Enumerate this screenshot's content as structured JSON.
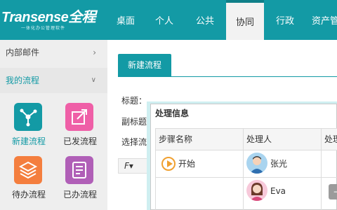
{
  "logo": {
    "name": "Transense全程",
    "tagline": "一体化办公管理软件"
  },
  "nav": {
    "items": [
      {
        "label": "桌面"
      },
      {
        "label": "个人"
      },
      {
        "label": "公共"
      },
      {
        "label": "协同",
        "active": true
      },
      {
        "label": "行政"
      },
      {
        "label": "资产管"
      }
    ]
  },
  "sidebar": {
    "mail_label": "内部邮件",
    "flow_label": "我的流程",
    "tiles": [
      {
        "label": "新建流程",
        "icon": "new-flow-icon",
        "color": "#139aa5"
      },
      {
        "label": "已发流程",
        "icon": "sent-flow-icon",
        "color": "#ef5fa7"
      },
      {
        "label": "待办流程",
        "icon": "todo-flow-icon",
        "color": "#f47e3e"
      },
      {
        "label": "已办流程",
        "icon": "done-flow-icon",
        "color": "#b05fb7"
      }
    ]
  },
  "content": {
    "tab_label": "新建流程",
    "title_label": "标题：",
    "subtitle_label": "副标题",
    "choose_label": "选择流",
    "editor_font_label": "F▾"
  },
  "dialog": {
    "title": "处理信息",
    "headers": [
      "步骤名称",
      "处理人",
      "处理"
    ],
    "rows": [
      {
        "step": "开始",
        "handler": "张光"
      },
      {
        "step": "",
        "handler": "Eva"
      }
    ]
  },
  "colors": {
    "accent": "#139aa5",
    "sidebar_bg": "#eeeeee"
  }
}
